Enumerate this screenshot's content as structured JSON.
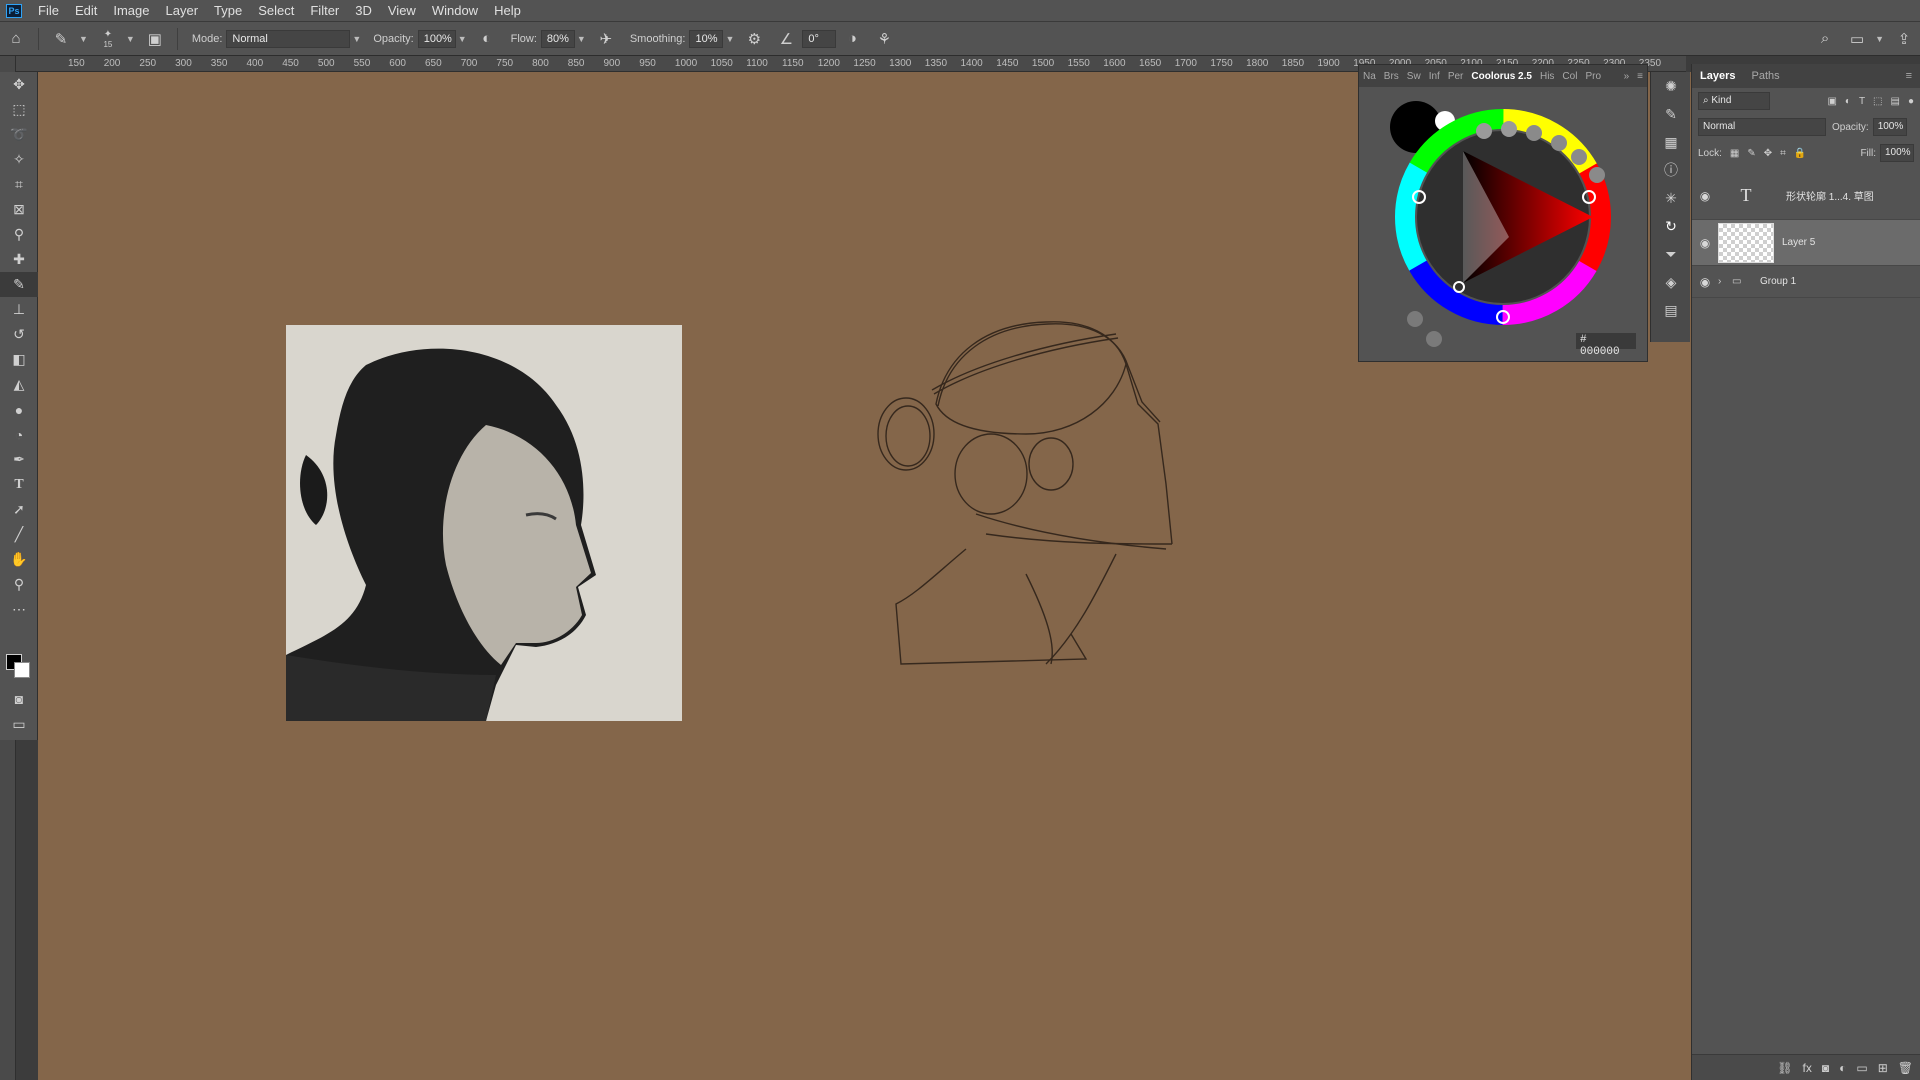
{
  "app": {
    "logo": "Ps"
  },
  "menu": [
    "File",
    "Edit",
    "Image",
    "Layer",
    "Type",
    "Select",
    "Filter",
    "3D",
    "View",
    "Window",
    "Help"
  ],
  "options": {
    "brush_size": "15",
    "mode_label": "Mode:",
    "mode_value": "Normal",
    "opacity_label": "Opacity:",
    "opacity_value": "100%",
    "flow_label": "Flow:",
    "flow_value": "80%",
    "smoothing_label": "Smoothing:",
    "smoothing_value": "10%",
    "angle_value": "0°"
  },
  "ruler": {
    "ticks": [
      "150",
      "200",
      "250",
      "300",
      "350",
      "400",
      "450",
      "500",
      "550",
      "600",
      "650",
      "700",
      "750",
      "800",
      "850",
      "900",
      "950",
      "1000",
      "1050",
      "1100",
      "1150",
      "1200",
      "1250",
      "1300",
      "1350",
      "1400",
      "1450",
      "1500",
      "1550",
      "1600",
      "1650",
      "1700",
      "1750",
      "1800",
      "1850",
      "1900",
      "1950",
      "2000",
      "2050",
      "2100",
      "2150",
      "2200",
      "2250",
      "2300",
      "2350"
    ]
  },
  "colour_panel": {
    "tabs": [
      "Na",
      "Brs",
      "Sw",
      "Inf",
      "Per",
      "Coolorus 2.5",
      "His",
      "Col",
      "Pro"
    ],
    "active_tab": "Coolorus 2.5",
    "hex_value": "000000",
    "hex_prefix": "#",
    "foreground_color": "#000000",
    "background_color": "#ffffff"
  },
  "layers_panel": {
    "tabs": [
      "Layers",
      "Paths"
    ],
    "filter_label": "Kind",
    "blend_mode": "Normal",
    "opacity_label": "Opacity:",
    "opacity_value": "100%",
    "lock_label": "Lock:",
    "fill_label": "Fill:",
    "fill_value": "100%",
    "layers": [
      {
        "name": "形状轮廓 1...4. 草图",
        "type": "text"
      },
      {
        "name": "Layer 5",
        "type": "pixel",
        "selected": true
      },
      {
        "name": "Group 1",
        "type": "group"
      }
    ]
  },
  "canvas": {
    "background_color": "#84664a"
  },
  "icons": {
    "tools": [
      "move-icon",
      "marquee-icon",
      "lasso-icon",
      "magic-wand-icon",
      "crop-icon",
      "frame-icon",
      "eyedropper-icon",
      "healing-icon",
      "brush-icon",
      "stamp-icon",
      "history-brush-icon",
      "eraser-icon",
      "bucket-icon",
      "blur-icon",
      "dodge-icon",
      "pen-icon",
      "type-icon",
      "path-select-icon",
      "line-icon",
      "hand-icon",
      "zoom-icon",
      "more-icon"
    ]
  }
}
